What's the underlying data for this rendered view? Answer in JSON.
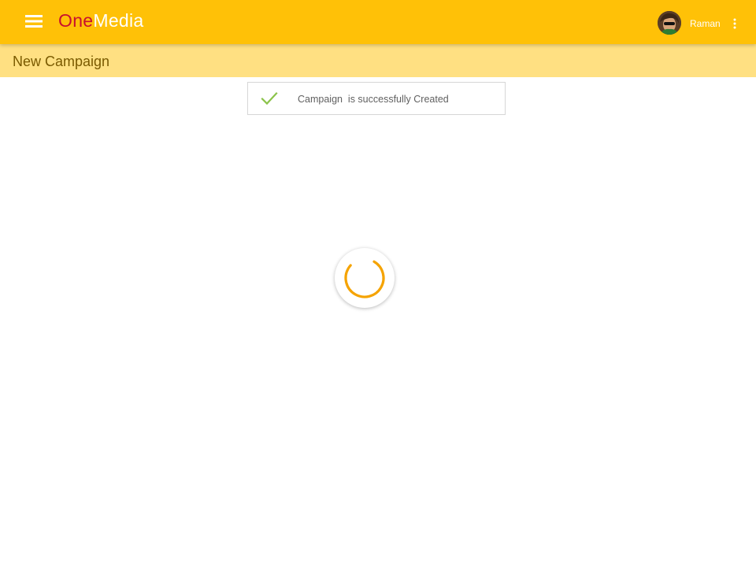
{
  "header": {
    "brand_one": "One",
    "brand_media": "Media",
    "user_name": "Raman",
    "icons": {
      "menu": "hamburger-menu-icon",
      "more": "more-vert-icon",
      "avatar": "user-avatar"
    }
  },
  "page": {
    "title": "New Campaign"
  },
  "toast": {
    "message": "Campaign  is successfully Created",
    "icon": "check-icon"
  },
  "loader": {
    "icon": "loading-spinner"
  },
  "colors": {
    "app_bar": "#ffc107",
    "sub_header": "#ffe082",
    "brand_one": "#c8102e",
    "brand_media": "#ffffff",
    "spinner": "#f5a300",
    "check": "#8bc34a"
  }
}
